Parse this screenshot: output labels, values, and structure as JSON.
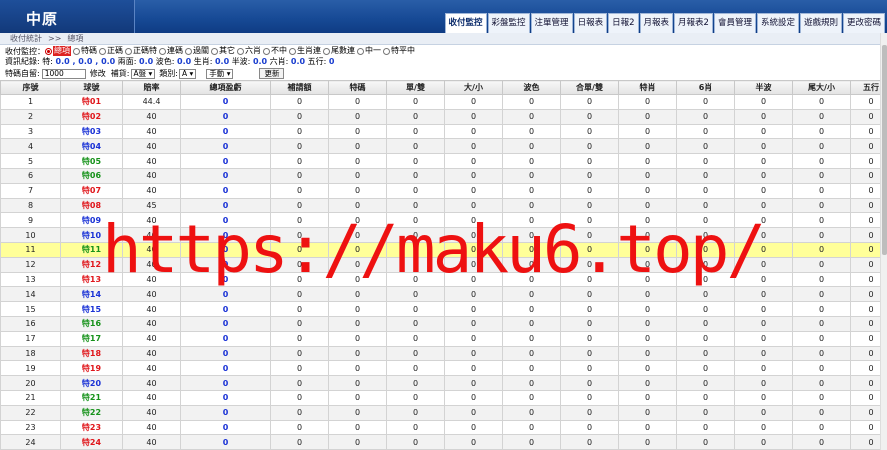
{
  "app": {
    "logo": "中原"
  },
  "tabs": [
    "收付監控",
    "彩盤監控",
    "注單管理",
    "日報表",
    "日報2",
    "月報表",
    "月報表2",
    "會員管理",
    "系統設定",
    "遊戲規則",
    "更改密碼"
  ],
  "active_tab": 0,
  "breadcrumb": {
    "a": "收付統計",
    "sep": ">>",
    "b": "總項"
  },
  "monitor": {
    "label": "收付監控：",
    "options": [
      "總項",
      "特碼",
      "正碼",
      "正碼特",
      "連碼",
      "過關",
      "其它",
      "六肖",
      "不中",
      "生肖連",
      "尾數連",
      "中一",
      "特平中"
    ],
    "selected": 0
  },
  "info": {
    "label": "資訊紀錄:",
    "t1": "特:",
    "v1": "0.0 , 0.0 , 0.0",
    "t2": "兩面:",
    "v2": "0.0",
    "t3": "波色:",
    "v3": "0.0",
    "t4": "生肖:",
    "v4": "0.0",
    "t5": "半波:",
    "v5": "0.0",
    "t6": "六肖:",
    "v6": "0.0",
    "t7": "五行:",
    "v7": "0"
  },
  "filter": {
    "label1": "特碼自留:",
    "value1": "1000",
    "label2": "修改",
    "label3": "補貨:",
    "sel3": "A盤",
    "label4": "類別:",
    "sel4": "A",
    "sel5": "手動",
    "refresh": "更新"
  },
  "columns": [
    "序號",
    "球號",
    "賠率",
    "總項盈虧",
    "補請額",
    "特碼",
    "單/雙",
    "大/小",
    "波色",
    "合單/雙",
    "特肖",
    "6肖",
    "半波",
    "尾大/小",
    "五行"
  ],
  "rows": [
    {
      "no": "1",
      "ball": "特01",
      "c": "red",
      "odds": "44.4"
    },
    {
      "no": "2",
      "ball": "特02",
      "c": "red",
      "odds": "40"
    },
    {
      "no": "3",
      "ball": "特03",
      "c": "bl",
      "odds": "40"
    },
    {
      "no": "4",
      "ball": "特04",
      "c": "bl",
      "odds": "40"
    },
    {
      "no": "5",
      "ball": "特05",
      "c": "gr",
      "odds": "40"
    },
    {
      "no": "6",
      "ball": "特06",
      "c": "gr",
      "odds": "40"
    },
    {
      "no": "7",
      "ball": "特07",
      "c": "red",
      "odds": "40"
    },
    {
      "no": "8",
      "ball": "特08",
      "c": "red",
      "odds": "45"
    },
    {
      "no": "9",
      "ball": "特09",
      "c": "bl",
      "odds": "40"
    },
    {
      "no": "10",
      "ball": "特10",
      "c": "bl",
      "odds": "40"
    },
    {
      "no": "11",
      "ball": "特11",
      "c": "gr",
      "odds": "40"
    },
    {
      "no": "12",
      "ball": "特12",
      "c": "red",
      "odds": "40"
    },
    {
      "no": "13",
      "ball": "特13",
      "c": "red",
      "odds": "40"
    },
    {
      "no": "14",
      "ball": "特14",
      "c": "bl",
      "odds": "40"
    },
    {
      "no": "15",
      "ball": "特15",
      "c": "bl",
      "odds": "40"
    },
    {
      "no": "16",
      "ball": "特16",
      "c": "gr",
      "odds": "40"
    },
    {
      "no": "17",
      "ball": "特17",
      "c": "gr",
      "odds": "40"
    },
    {
      "no": "18",
      "ball": "特18",
      "c": "red",
      "odds": "40"
    },
    {
      "no": "19",
      "ball": "特19",
      "c": "red",
      "odds": "40"
    },
    {
      "no": "20",
      "ball": "特20",
      "c": "bl",
      "odds": "40"
    },
    {
      "no": "21",
      "ball": "特21",
      "c": "gr",
      "odds": "40"
    },
    {
      "no": "22",
      "ball": "特22",
      "c": "gr",
      "odds": "40"
    },
    {
      "no": "23",
      "ball": "特23",
      "c": "red",
      "odds": "40"
    },
    {
      "no": "24",
      "ball": "特24",
      "c": "red",
      "odds": "40"
    }
  ],
  "highlight_row": 10,
  "zero": "0",
  "watermark": "https://maku6.top/"
}
